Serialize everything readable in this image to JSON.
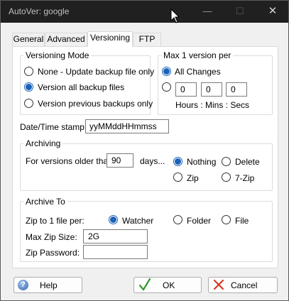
{
  "window": {
    "title": "AutoVer: google"
  },
  "titlebar": {
    "minimize": "—",
    "maximize": "☐",
    "close": "✕"
  },
  "tabs": [
    {
      "label": "General"
    },
    {
      "label": "Advanced"
    },
    {
      "label": "Versioning",
      "active": true
    },
    {
      "label": "FTP"
    }
  ],
  "versioning_mode": {
    "title": "Versioning Mode",
    "options": [
      {
        "label": "None - Update backup file only",
        "selected": false
      },
      {
        "label": "Version all backup files",
        "selected": true
      },
      {
        "label": "Version previous backups only",
        "selected": false
      }
    ]
  },
  "max_version": {
    "title": "Max 1 version per",
    "all_changes_label": "All Changes",
    "all_changes_selected": true,
    "custom_selected": false,
    "hours": "0",
    "mins": "0",
    "secs": "0",
    "caption": "Hours : Mins : Secs"
  },
  "timestamp": {
    "label": "Date/Time stamp:",
    "value": "yyMMddHHmmss"
  },
  "archiving": {
    "title": "Archiving",
    "prefix": "For versions older than",
    "days_value": "90",
    "suffix": "days...",
    "options": {
      "nothing": "Nothing",
      "delete": "Delete",
      "zip": "Zip",
      "sevenzip": "7-Zip"
    },
    "selected": "nothing"
  },
  "archive_to": {
    "title": "Archive To",
    "zip_per_label": "Zip to 1 file per:",
    "options": {
      "watcher": "Watcher",
      "folder": "Folder",
      "file": "File"
    },
    "selected": "watcher",
    "max_zip_label": "Max Zip Size:",
    "max_zip_value": "2G",
    "password_label": "Zip Password:",
    "password_value": ""
  },
  "buttons": {
    "help": "Help",
    "ok": "OK",
    "cancel": "Cancel"
  },
  "colors": {
    "accent": "#1b62b8",
    "titlebar": "#202020",
    "ok_check": "#2e9b2e",
    "cancel_x": "#d23a2a"
  }
}
